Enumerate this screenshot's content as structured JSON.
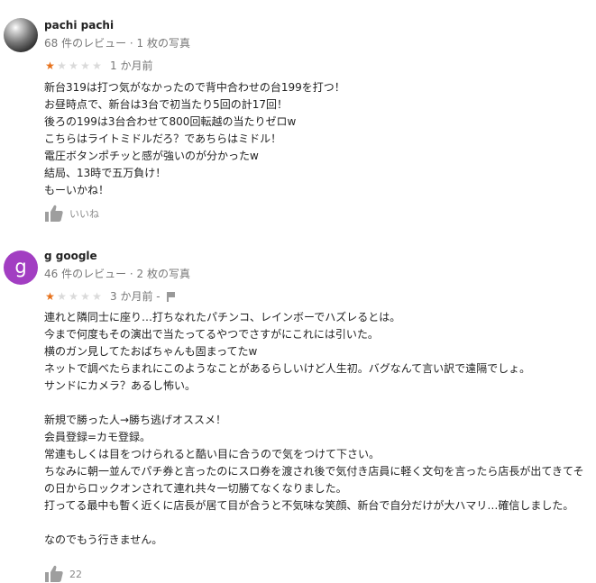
{
  "reviews": [
    {
      "reviewer": "pachi pachi",
      "meta": "68 件のレビュー · 1 枚の写真",
      "rating": 1,
      "max_rating": 5,
      "age": "1 か月前",
      "body": "新台319は打つ気がなかったので背中合わせの台199を打つ！\nお昼時点で、新台は3台で初当たり5回の計17回！\n後ろの199は3台合わせて800回転越の当たりゼロw\nこちらはライトミドルだろ？であちらはミドル！\n電圧ボタンポチッと感が強いのが分かったw\n結局、13時で五万負け！\nもーいかね！",
      "like_label": "いいね",
      "avatar_icon": "metal-ball-icon"
    },
    {
      "reviewer": "g google",
      "meta": "46 件のレビュー · 2 枚の写真",
      "rating": 1,
      "max_rating": 5,
      "age": "3 か月前 -",
      "body": "連れと隣同士に座り…打ちなれたパチンコ、レインボーでハズレるとは。\n今まで何度もその演出で当たってるやつでさすがにこれには引いた。\n横のガン見してたおばちゃんも固まってたw\nネットで調べたらまれにこのようなことがあるらしいけど人生初。バグなんて言い訳で遠隔でしょ。\nサンドにカメラ？あるし怖い。\n\n新規で勝った人→勝ち逃げオススメ！\n会員登録=カモ登録。\n常連もしくは目をつけられると酷い目に合うので気をつけて下さい。\nちなみに朝一並んでパチ券と言ったのにスロ券を渡され後で気付き店員に軽く文句を言ったら店長が出てきてその日からロックオンされて連れ共々一切勝てなくなりました。\n打ってる最中も暫く近くに店長が居て目が合うと不気味な笑顔、新台で自分だけが大ハマリ…確信しました。\n\nなのでもう行きません。",
      "like_label": "22",
      "avatar_letter": "g",
      "avatar_color": "#a23ec2"
    }
  ],
  "colors": {
    "star_filled": "#e7711b",
    "star_empty": "#dadada",
    "secondary_text": "#777777"
  }
}
